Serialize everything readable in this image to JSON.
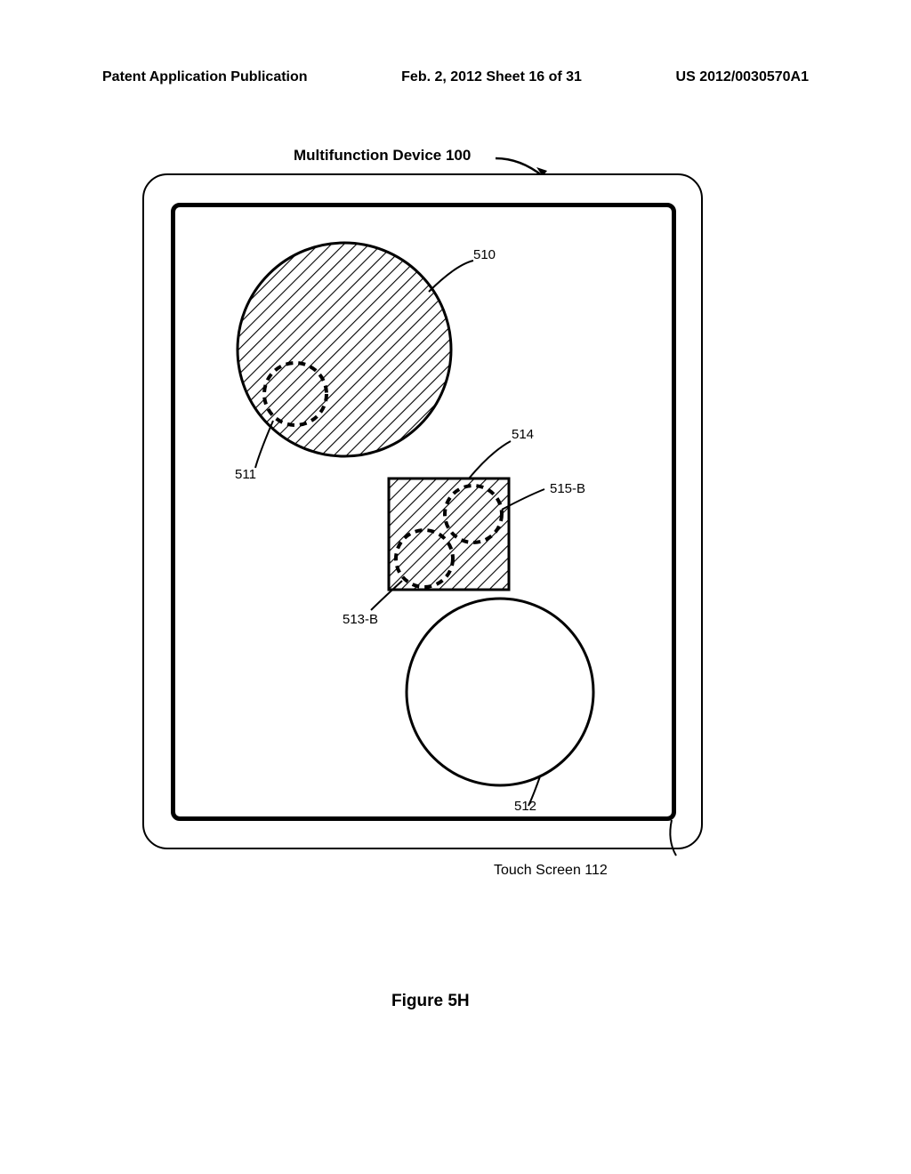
{
  "header": {
    "left": "Patent Application Publication",
    "center": "Feb. 2, 2012   Sheet 16 of 31",
    "right": "US 2012/0030570A1"
  },
  "title": "Multifunction Device 100",
  "touch_screen": "Touch Screen 112",
  "figure": "Figure 5H",
  "refs": {
    "r510": "510",
    "r511": "511",
    "r512": "512",
    "r513b": "513-B",
    "r514": "514",
    "r515b": "515-B"
  }
}
